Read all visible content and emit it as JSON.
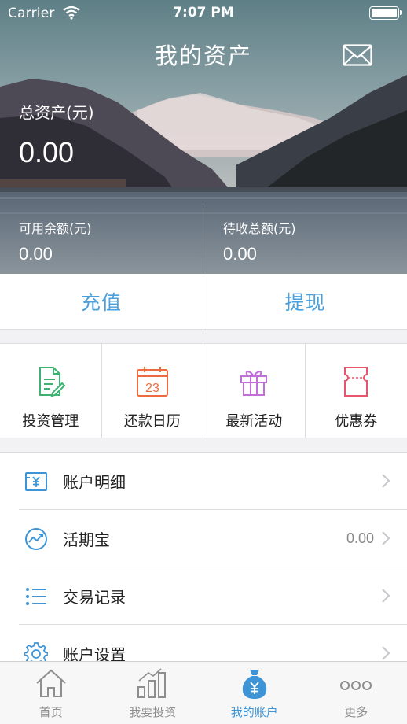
{
  "status_bar": {
    "carrier": "Carrier",
    "time": "7:07 PM"
  },
  "header": {
    "title": "我的资产",
    "mail_icon": "mail-icon"
  },
  "summary": {
    "total_label": "总资产(元)",
    "total_value": "0.00",
    "available_label": "可用余额(元)",
    "available_value": "0.00",
    "pending_label": "待收总额(元)",
    "pending_value": "0.00"
  },
  "actions": {
    "recharge_label": "充值",
    "withdraw_label": "提现",
    "accent_color": "#4aa0dc"
  },
  "grid": [
    {
      "label": "投资管理",
      "icon": "document-edit-icon",
      "color": "#3cb371"
    },
    {
      "label": "还款日历",
      "icon": "calendar-icon",
      "day": "23",
      "color": "#ef6a3f"
    },
    {
      "label": "最新活动",
      "icon": "gift-icon",
      "color": "#c06fd8"
    },
    {
      "label": "优惠券",
      "icon": "coupon-icon",
      "color": "#e8566e"
    }
  ],
  "list": [
    {
      "label": "账户明细",
      "icon": "yen-card-icon",
      "value": ""
    },
    {
      "label": "活期宝",
      "icon": "trend-chart-icon",
      "value": "0.00"
    },
    {
      "label": "交易记录",
      "icon": "list-icon",
      "value": ""
    },
    {
      "label": "账户设置",
      "icon": "gear-icon",
      "value": ""
    }
  ],
  "tabbar": [
    {
      "label": "首页",
      "icon": "home-icon",
      "active": false
    },
    {
      "label": "我要投资",
      "icon": "bar-chart-icon",
      "active": false
    },
    {
      "label": "我的账户",
      "icon": "money-bag-icon",
      "active": true
    },
    {
      "label": "更多",
      "icon": "more-icon",
      "active": false
    }
  ],
  "colors": {
    "tab_active": "#3d95d8",
    "tab_inactive": "#8e8e8e",
    "list_icon": "#3d95d8"
  }
}
